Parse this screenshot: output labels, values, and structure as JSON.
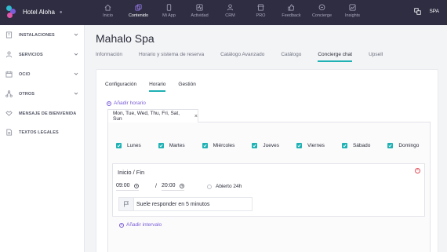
{
  "brand": {
    "name": "Hotel Aloha",
    "colors": [
      "#2fbcd0",
      "#7a5cd6",
      "#e056a8"
    ]
  },
  "nav": [
    {
      "label": "Inicio",
      "icon": "home-icon",
      "active": false
    },
    {
      "label": "Contenido",
      "icon": "layers-icon",
      "active": true
    },
    {
      "label": "Mi App",
      "icon": "phone-icon",
      "active": false
    },
    {
      "label": "Actividad",
      "icon": "activity-icon",
      "active": false
    },
    {
      "label": "CRM",
      "icon": "users-icon",
      "active": false
    },
    {
      "label": "PRO",
      "icon": "store-icon",
      "active": false
    },
    {
      "label": "Feedback",
      "icon": "thumbs-up-icon",
      "active": false
    },
    {
      "label": "Concierge",
      "icon": "chat-icon",
      "active": false
    },
    {
      "label": "Insights",
      "icon": "chart-icon",
      "active": false
    }
  ],
  "language": "SPA",
  "sidebar": [
    {
      "label": "INSTALACIONES",
      "icon": "building-icon",
      "expandable": true
    },
    {
      "label": "SERVICIOS",
      "icon": "person-icon",
      "expandable": true
    },
    {
      "label": "OCIO",
      "icon": "calendar-icon",
      "expandable": true
    },
    {
      "label": "OTROS",
      "icon": "nodes-icon",
      "expandable": true
    },
    {
      "label": "MENSAJE DE BIENVENIDA",
      "icon": "handshake-icon",
      "expandable": false
    },
    {
      "label": "TEXTOS LEGALES",
      "icon": "document-icon",
      "expandable": false
    }
  ],
  "page": {
    "title": "Mahalo Spa",
    "tabs": [
      "Información",
      "Horario y sistema de reserva",
      "Catálogo Avanzado",
      "Catálogo",
      "Concierge chat",
      "Upsell"
    ],
    "active_tab": "Concierge chat"
  },
  "card": {
    "subtabs": [
      "Configuración",
      "Horario",
      "Gestión"
    ],
    "active_subtab": "Horario",
    "add_schedule": "Añadir horario",
    "days_tab": "Mon, Tue, Wed, Thu, Fri, Sat, Sun",
    "days": [
      {
        "label": "Lunes",
        "checked": true
      },
      {
        "label": "Martes",
        "checked": true
      },
      {
        "label": "Miércoles",
        "checked": true
      },
      {
        "label": "Jueves",
        "checked": true
      },
      {
        "label": "Viernes",
        "checked": true
      },
      {
        "label": "Sábado",
        "checked": true
      },
      {
        "label": "Domingo",
        "checked": true
      }
    ],
    "interval": {
      "title": "Inicio / Fin",
      "start": "09:00",
      "separator": "/",
      "end": "20:00",
      "open_24h": "Abierto 24h",
      "message": "Suele responder en 5 minutos"
    },
    "add_interval": "Añadir intervalo"
  },
  "colors": {
    "topbar": "#2e2d42",
    "accent": "#1fb1b4",
    "link": "#7a5cd6",
    "danger": "#e2545f"
  }
}
